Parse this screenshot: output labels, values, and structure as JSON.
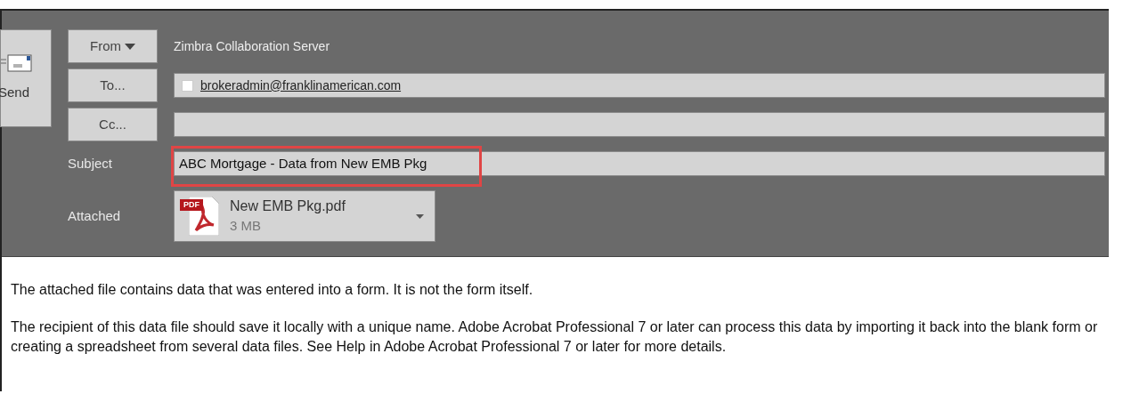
{
  "send_button": {
    "label": "Send"
  },
  "header_rows": [
    {
      "kind": "from",
      "button": "From",
      "value": "Zimbra Collaboration Server"
    },
    {
      "kind": "recipients",
      "button": "To...",
      "recipients": [
        {
          "address": "brokeradmin@franklinamerican.com",
          "checked": false
        }
      ]
    },
    {
      "kind": "recipients",
      "button": "Cc...",
      "recipients": []
    },
    {
      "kind": "subject",
      "label": "Subject",
      "value": "ABC Mortgage - Data from New EMB Pkg",
      "highlighted": true
    },
    {
      "kind": "attachment",
      "label": "Attached",
      "file_name": "New EMB Pkg.pdf",
      "file_size": "3 MB",
      "file_badge": "PDF"
    }
  ],
  "body": [
    "The attached file contains data that was entered into a form. It is not the form itself.",
    "The recipient of this data file should save it locally with a unique name. Adobe Acrobat Professional 7 or later can process this data by importing it back into the blank form or creating a spreadsheet from several data files. See Help in Adobe Acrobat Professional 7 or later for more details."
  ]
}
